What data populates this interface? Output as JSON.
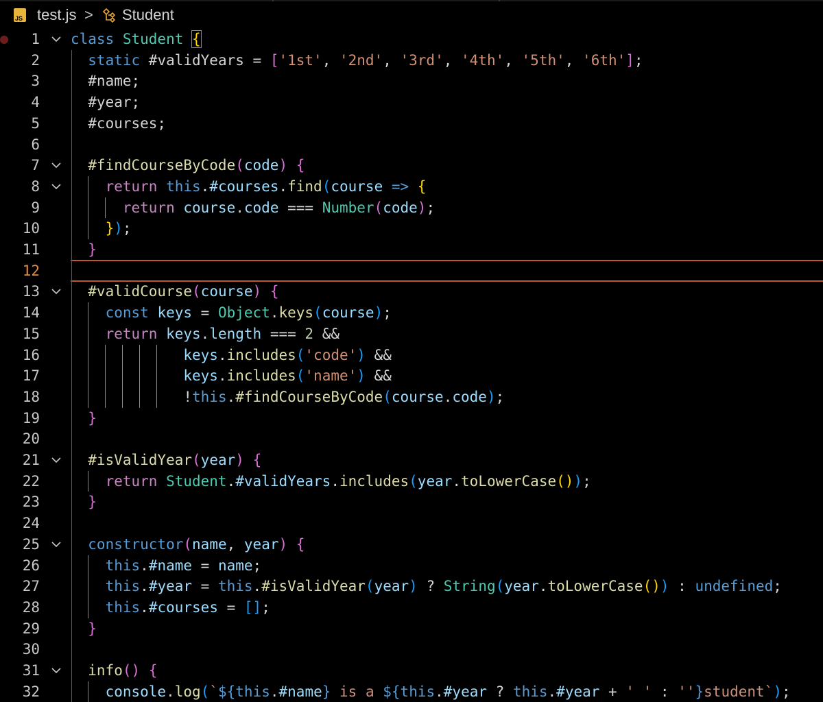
{
  "breadcrumb": {
    "file_icon_text": "JS",
    "file": "test.js",
    "separator": ">",
    "symbol": "Student"
  },
  "editor": {
    "current_line": 12,
    "lines": [
      {
        "n": "1",
        "fold": true,
        "breakpoint": true,
        "tokens": [
          [
            "kw",
            "class "
          ],
          [
            "cls",
            "Student "
          ],
          [
            "br1",
            "{"
          ]
        ]
      },
      {
        "n": "2",
        "tokens": [
          [
            "kw",
            "  static "
          ],
          [
            "op",
            "#validYears = "
          ],
          [
            "br2",
            "["
          ],
          [
            "str",
            "'1st'"
          ],
          [
            "op",
            ", "
          ],
          [
            "str",
            "'2nd'"
          ],
          [
            "op",
            ", "
          ],
          [
            "str",
            "'3rd'"
          ],
          [
            "op",
            ", "
          ],
          [
            "str",
            "'4th'"
          ],
          [
            "op",
            ", "
          ],
          [
            "str",
            "'5th'"
          ],
          [
            "op",
            ", "
          ],
          [
            "str",
            "'6th'"
          ],
          [
            "br2",
            "]"
          ],
          [
            "op",
            ";"
          ]
        ]
      },
      {
        "n": "3",
        "tokens": [
          [
            "op",
            "  #name;"
          ]
        ]
      },
      {
        "n": "4",
        "tokens": [
          [
            "op",
            "  #year;"
          ]
        ]
      },
      {
        "n": "5",
        "tokens": [
          [
            "op",
            "  #courses;"
          ]
        ]
      },
      {
        "n": "6",
        "tokens": []
      },
      {
        "n": "7",
        "fold": true,
        "tokens": [
          [
            "fn",
            "  #findCourseByCode"
          ],
          [
            "br2",
            "("
          ],
          [
            "var",
            "code"
          ],
          [
            "br2",
            ")"
          ],
          [
            "op",
            " "
          ],
          [
            "br2",
            "{"
          ]
        ]
      },
      {
        "n": "8",
        "fold": true,
        "tokens": [
          [
            "ctl",
            "    return "
          ],
          [
            "kw",
            "this"
          ],
          [
            "op",
            "."
          ],
          [
            "var",
            "#courses"
          ],
          [
            "op",
            "."
          ],
          [
            "fn",
            "find"
          ],
          [
            "br3",
            "("
          ],
          [
            "var",
            "course"
          ],
          [
            "kw",
            " => "
          ],
          [
            "br1",
            "{"
          ]
        ]
      },
      {
        "n": "9",
        "tokens": [
          [
            "ctl",
            "      return "
          ],
          [
            "var",
            "course"
          ],
          [
            "op",
            "."
          ],
          [
            "var",
            "code"
          ],
          [
            "op",
            " === "
          ],
          [
            "cls",
            "Number"
          ],
          [
            "br2",
            "("
          ],
          [
            "var",
            "code"
          ],
          [
            "br2",
            ")"
          ],
          [
            "op",
            ";"
          ]
        ]
      },
      {
        "n": "10",
        "tokens": [
          [
            "br1",
            "    }"
          ],
          [
            "br3",
            ")"
          ],
          [
            "op",
            ";"
          ]
        ]
      },
      {
        "n": "11",
        "tokens": [
          [
            "br2",
            "  }"
          ]
        ]
      },
      {
        "n": "12",
        "tokens": []
      },
      {
        "n": "13",
        "fold": true,
        "tokens": [
          [
            "fn",
            "  #validCourse"
          ],
          [
            "br2",
            "("
          ],
          [
            "var",
            "course"
          ],
          [
            "br2",
            ")"
          ],
          [
            "op",
            " "
          ],
          [
            "br2",
            "{"
          ]
        ]
      },
      {
        "n": "14",
        "tokens": [
          [
            "kw",
            "    const "
          ],
          [
            "var",
            "keys"
          ],
          [
            "op",
            " = "
          ],
          [
            "cls",
            "Object"
          ],
          [
            "op",
            "."
          ],
          [
            "fn",
            "keys"
          ],
          [
            "br3",
            "("
          ],
          [
            "var",
            "course"
          ],
          [
            "br3",
            ")"
          ],
          [
            "op",
            ";"
          ]
        ]
      },
      {
        "n": "15",
        "tokens": [
          [
            "ctl",
            "    return "
          ],
          [
            "var",
            "keys"
          ],
          [
            "op",
            "."
          ],
          [
            "var",
            "length"
          ],
          [
            "op",
            " === "
          ],
          [
            "num",
            "2"
          ],
          [
            "op",
            " &&"
          ]
        ]
      },
      {
        "n": "16",
        "tokens": [
          [
            "var",
            "             keys"
          ],
          [
            "op",
            "."
          ],
          [
            "fn",
            "includes"
          ],
          [
            "br3",
            "("
          ],
          [
            "str",
            "'code'"
          ],
          [
            "br3",
            ")"
          ],
          [
            "op",
            " &&"
          ]
        ]
      },
      {
        "n": "17",
        "tokens": [
          [
            "var",
            "             keys"
          ],
          [
            "op",
            "."
          ],
          [
            "fn",
            "includes"
          ],
          [
            "br3",
            "("
          ],
          [
            "str",
            "'name'"
          ],
          [
            "br3",
            ")"
          ],
          [
            "op",
            " &&"
          ]
        ]
      },
      {
        "n": "18",
        "tokens": [
          [
            "op",
            "             !"
          ],
          [
            "kw",
            "this"
          ],
          [
            "op",
            "."
          ],
          [
            "fn",
            "#findCourseByCode"
          ],
          [
            "br3",
            "("
          ],
          [
            "var",
            "course"
          ],
          [
            "op",
            "."
          ],
          [
            "var",
            "code"
          ],
          [
            "br3",
            ")"
          ],
          [
            "op",
            ";"
          ]
        ]
      },
      {
        "n": "19",
        "tokens": [
          [
            "br2",
            "  }"
          ]
        ]
      },
      {
        "n": "20",
        "tokens": []
      },
      {
        "n": "21",
        "fold": true,
        "tokens": [
          [
            "fn",
            "  #isValidYear"
          ],
          [
            "br2",
            "("
          ],
          [
            "var",
            "year"
          ],
          [
            "br2",
            ")"
          ],
          [
            "op",
            " "
          ],
          [
            "br2",
            "{"
          ]
        ]
      },
      {
        "n": "22",
        "tokens": [
          [
            "ctl",
            "    return "
          ],
          [
            "cls",
            "Student"
          ],
          [
            "op",
            "."
          ],
          [
            "var",
            "#validYears"
          ],
          [
            "op",
            "."
          ],
          [
            "fn",
            "includes"
          ],
          [
            "br3",
            "("
          ],
          [
            "var",
            "year"
          ],
          [
            "op",
            "."
          ],
          [
            "fn",
            "toLowerCase"
          ],
          [
            "br1",
            "()"
          ],
          [
            "br3",
            ")"
          ],
          [
            "op",
            ";"
          ]
        ]
      },
      {
        "n": "23",
        "tokens": [
          [
            "br2",
            "  }"
          ]
        ]
      },
      {
        "n": "24",
        "tokens": []
      },
      {
        "n": "25",
        "fold": true,
        "tokens": [
          [
            "kw",
            "  constructor"
          ],
          [
            "br2",
            "("
          ],
          [
            "var",
            "name"
          ],
          [
            "op",
            ", "
          ],
          [
            "var",
            "year"
          ],
          [
            "br2",
            ")"
          ],
          [
            "op",
            " "
          ],
          [
            "br2",
            "{"
          ]
        ]
      },
      {
        "n": "26",
        "tokens": [
          [
            "kw",
            "    this"
          ],
          [
            "op",
            "."
          ],
          [
            "var",
            "#name"
          ],
          [
            "op",
            " = "
          ],
          [
            "var",
            "name"
          ],
          [
            "op",
            ";"
          ]
        ]
      },
      {
        "n": "27",
        "tokens": [
          [
            "kw",
            "    this"
          ],
          [
            "op",
            "."
          ],
          [
            "var",
            "#year"
          ],
          [
            "op",
            " = "
          ],
          [
            "kw",
            "this"
          ],
          [
            "op",
            "."
          ],
          [
            "fn",
            "#isValidYear"
          ],
          [
            "br3",
            "("
          ],
          [
            "var",
            "year"
          ],
          [
            "br3",
            ")"
          ],
          [
            "op",
            " ? "
          ],
          [
            "cls",
            "String"
          ],
          [
            "br3",
            "("
          ],
          [
            "var",
            "year"
          ],
          [
            "op",
            "."
          ],
          [
            "fn",
            "toLowerCase"
          ],
          [
            "br1",
            "()"
          ],
          [
            "br3",
            ")"
          ],
          [
            "op",
            " : "
          ],
          [
            "kw",
            "undefined"
          ],
          [
            "op",
            ";"
          ]
        ]
      },
      {
        "n": "28",
        "tokens": [
          [
            "kw",
            "    this"
          ],
          [
            "op",
            "."
          ],
          [
            "var",
            "#courses"
          ],
          [
            "op",
            " = "
          ],
          [
            "br3",
            "[]"
          ],
          [
            "op",
            ";"
          ]
        ]
      },
      {
        "n": "29",
        "tokens": [
          [
            "br2",
            "  }"
          ]
        ]
      },
      {
        "n": "30",
        "tokens": []
      },
      {
        "n": "31",
        "fold": true,
        "tokens": [
          [
            "fn",
            "  info"
          ],
          [
            "br2",
            "()"
          ],
          [
            "op",
            " "
          ],
          [
            "br2",
            "{"
          ]
        ]
      },
      {
        "n": "32",
        "tokens": [
          [
            "var",
            "    console"
          ],
          [
            "op",
            "."
          ],
          [
            "fn",
            "log"
          ],
          [
            "br3",
            "("
          ],
          [
            "str",
            "`"
          ],
          [
            "kw",
            "${"
          ],
          [
            "kw",
            "this"
          ],
          [
            "op",
            "."
          ],
          [
            "var",
            "#name"
          ],
          [
            "kw",
            "}"
          ],
          [
            "str",
            " is a "
          ],
          [
            "kw",
            "${"
          ],
          [
            "kw",
            "this"
          ],
          [
            "op",
            "."
          ],
          [
            "var",
            "#year"
          ],
          [
            "op",
            " ? "
          ],
          [
            "kw",
            "this"
          ],
          [
            "op",
            "."
          ],
          [
            "var",
            "#year"
          ],
          [
            "op",
            " + "
          ],
          [
            "str",
            "' '"
          ],
          [
            "op",
            " : "
          ],
          [
            "str",
            "''"
          ],
          [
            "kw",
            "}"
          ],
          [
            "str",
            "student`"
          ],
          [
            "br3",
            ")"
          ],
          [
            "op",
            ";"
          ]
        ]
      }
    ]
  }
}
